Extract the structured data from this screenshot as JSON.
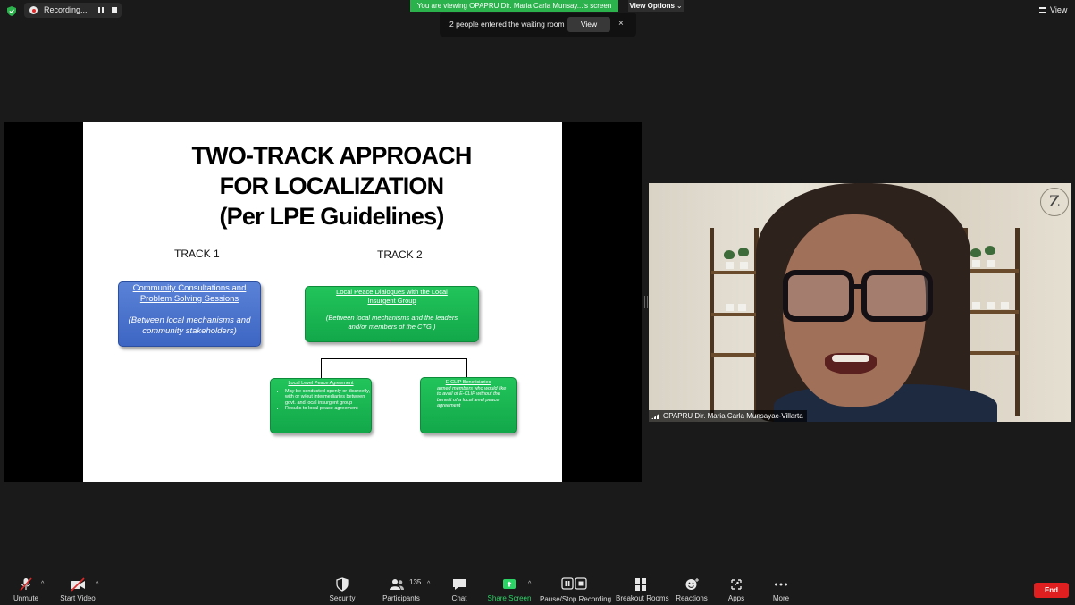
{
  "top_bar": {
    "recording_label": "Recording...",
    "viewing_banner": "You are viewing OPAPRU Dir. Maria Carla Munsay...'s screen",
    "view_options_label": "View Options",
    "view_label": "View"
  },
  "notification": {
    "text": "2 people entered the waiting room",
    "view_button": "View",
    "close": "×"
  },
  "slide": {
    "title_lines": [
      "TWO-TRACK APPROACH",
      "FOR LOCALIZATION",
      "(Per LPE Guidelines)"
    ],
    "track1_label": "TRACK 1",
    "track2_label": "TRACK 2",
    "track1_box": {
      "heading": "Community Consultations and Problem Solving Sessions",
      "detail": "(Between local mechanisms and community stakeholders)"
    },
    "track2_box": {
      "heading": "Local Peace Dialogues with the Local Insurgent Group",
      "detail": "(Between local mechanisms and the leaders and/or members of the CTG )"
    },
    "sub_box_left": {
      "heading": "Local Level Peace Agreement",
      "bullets": [
        "May be conducted openly or discreetly, with or w/out intermediaries between govt. and local insurgent group",
        "Results to local peace agreement"
      ]
    },
    "sub_box_right": {
      "heading": "E-CLIP Beneficiaries",
      "detail": "armed members who would like to avail of E-CLIP without the benefit of a local level peace agreement"
    }
  },
  "participant": {
    "name": "OPAPRU Dir. Maria Carla Munsayac-Villarta"
  },
  "toolbar": {
    "unmute": "Unmute",
    "start_video": "Start Video",
    "security": "Security",
    "participants": "Participants",
    "participant_count": "135",
    "chat": "Chat",
    "share_screen": "Share Screen",
    "pause_stop_recording": "Pause/Stop Recording",
    "breakout_rooms": "Breakout Rooms",
    "reactions": "Reactions",
    "apps": "Apps",
    "more": "More",
    "end": "End"
  },
  "colors": {
    "banner_green": "#2bb24c",
    "share_green": "#2bd565",
    "end_red": "#e02020",
    "box_blue": "#4a74cf",
    "box_green": "#17b24f"
  }
}
